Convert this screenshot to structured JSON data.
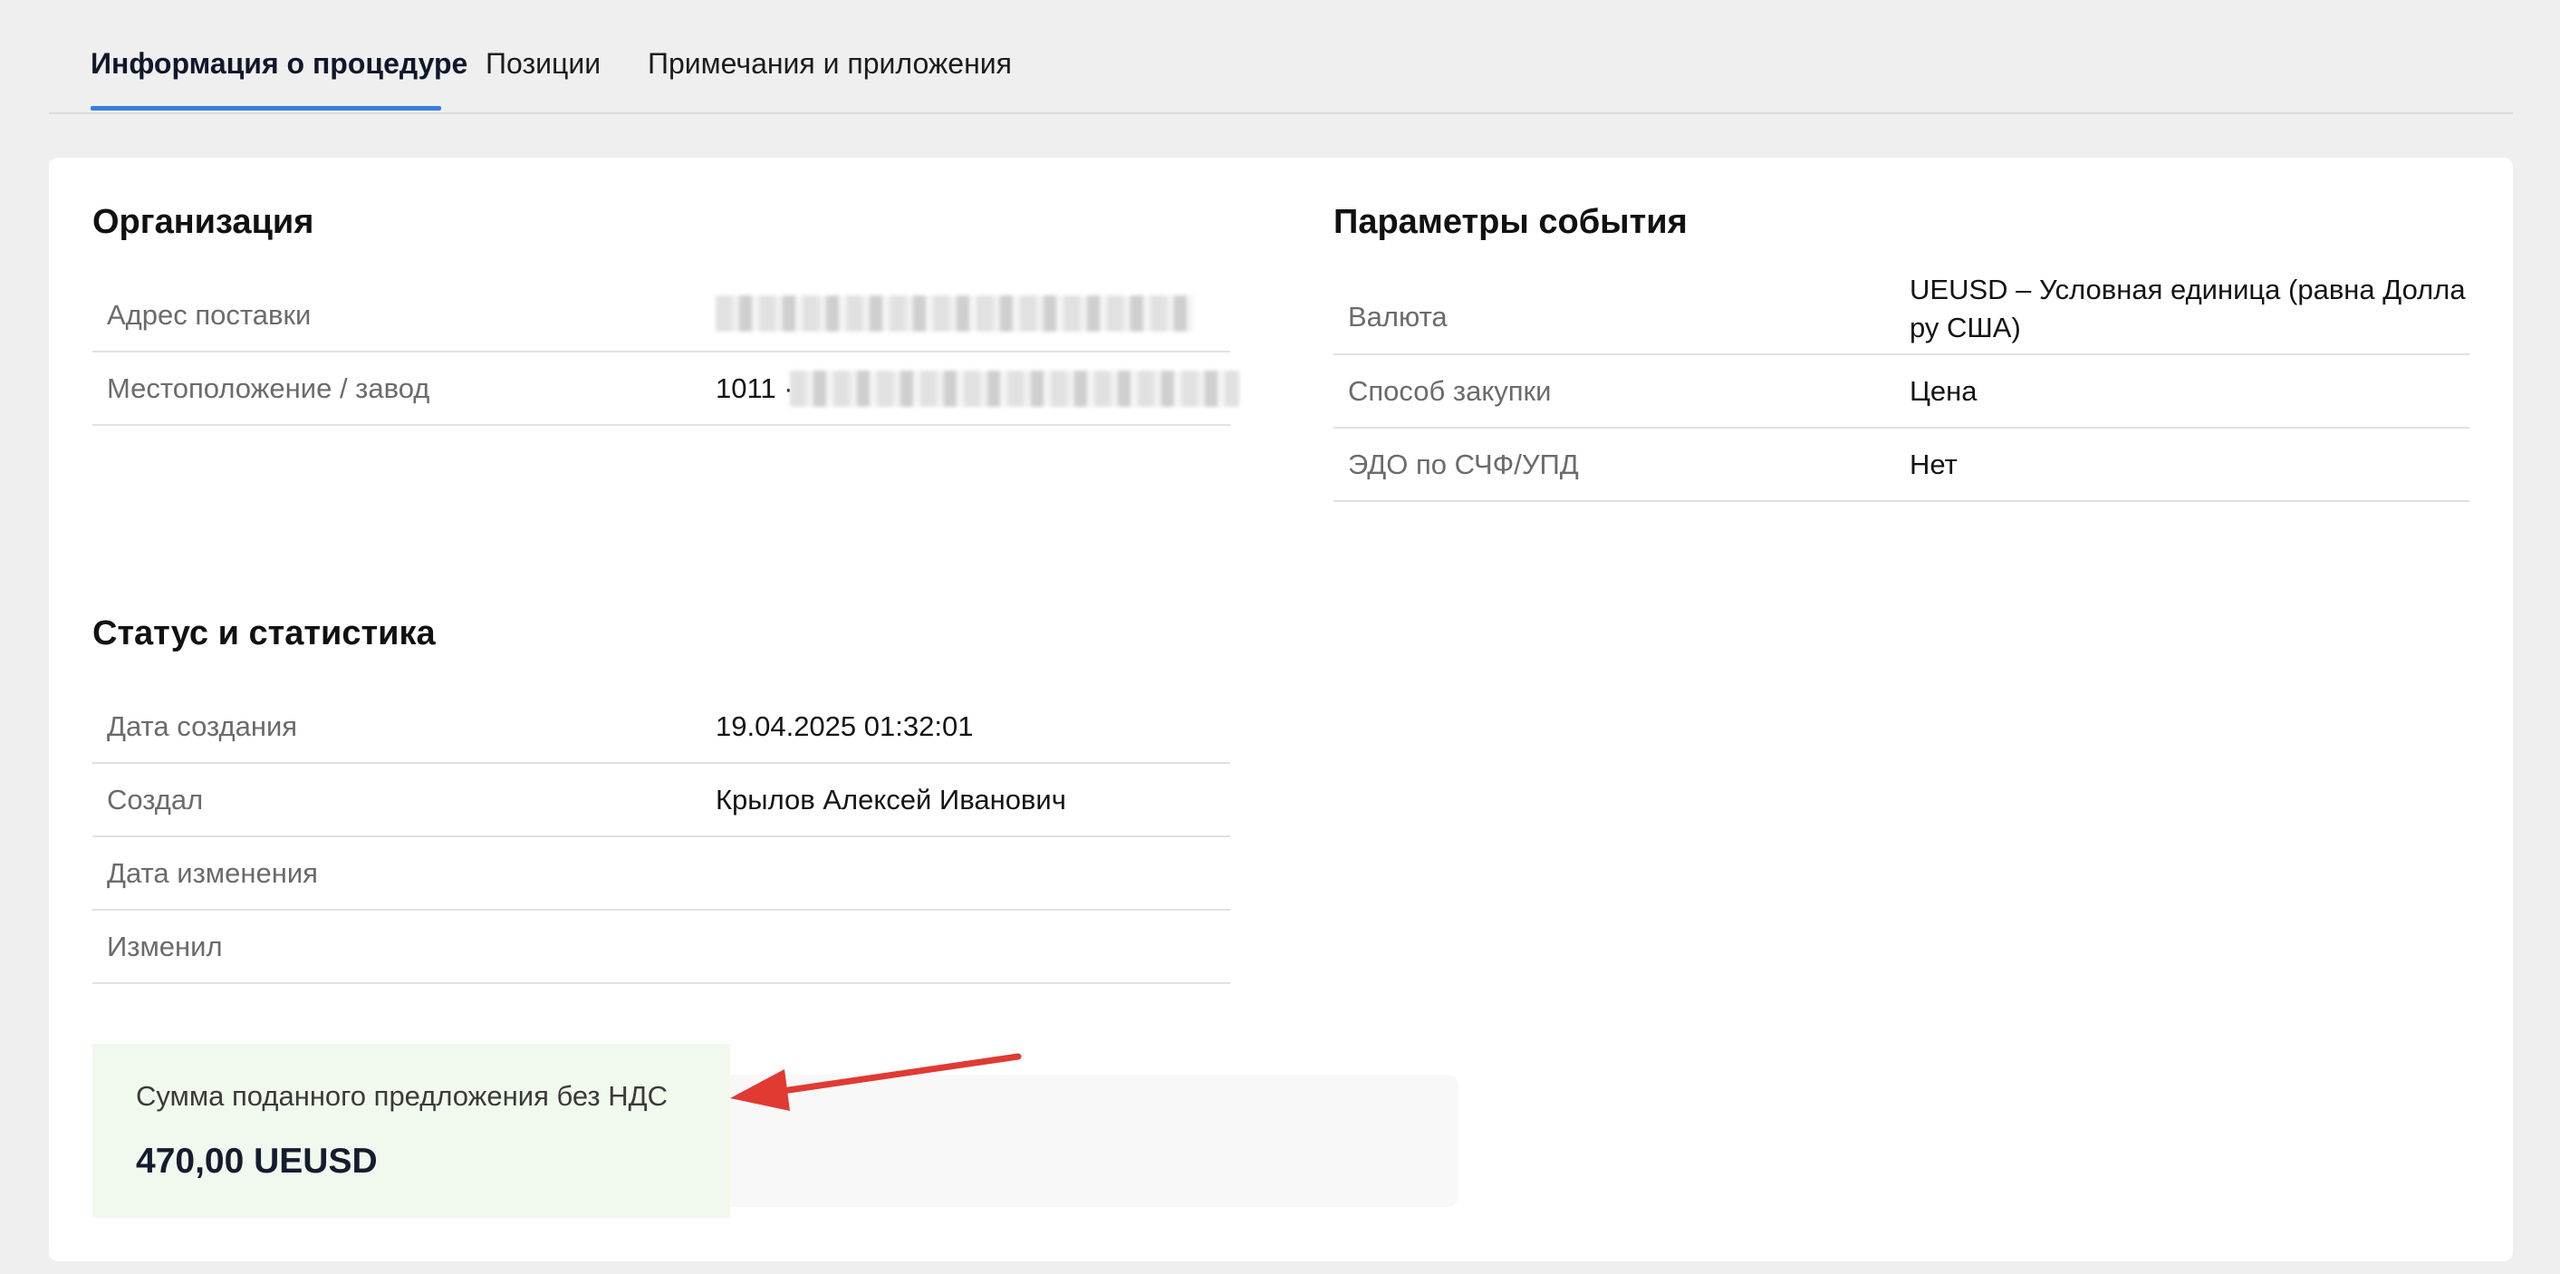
{
  "tabs": [
    {
      "label": "Информация о процедуре",
      "active": true
    },
    {
      "label": "Позиции",
      "active": false
    },
    {
      "label": "Примечания и приложения",
      "active": false
    }
  ],
  "organization": {
    "title": "Организация",
    "rows": [
      {
        "label": "Адрес поставки",
        "value": ""
      },
      {
        "label": "Местоположение / завод",
        "value": "1011 ·"
      }
    ]
  },
  "event_params": {
    "title": "Параметры события",
    "rows": [
      {
        "label": "Валюта",
        "value_line1": "UEUSD – Условная единица (равна Долла",
        "value_line2": "ру США)"
      },
      {
        "label": "Способ закупки",
        "value": "Цена"
      },
      {
        "label": "ЭДО по СЧФ/УПД",
        "value": "Нет"
      }
    ]
  },
  "status": {
    "title": "Статус и статистика",
    "rows": [
      {
        "label": "Дата создания",
        "value": "19.04.2025 01:32:01"
      },
      {
        "label": "Создал",
        "value": "Крылов Алексей Иванович"
      },
      {
        "label": "Дата изменения",
        "value": ""
      },
      {
        "label": "Изменил",
        "value": ""
      }
    ]
  },
  "summary": {
    "label": "Сумма поданного предложения без НДС",
    "value": "470,00 UEUSD"
  },
  "colors": {
    "accent": "#3b7ddd",
    "annotation_arrow": "#e03a33",
    "summary_bg": "#f1f8ee"
  }
}
